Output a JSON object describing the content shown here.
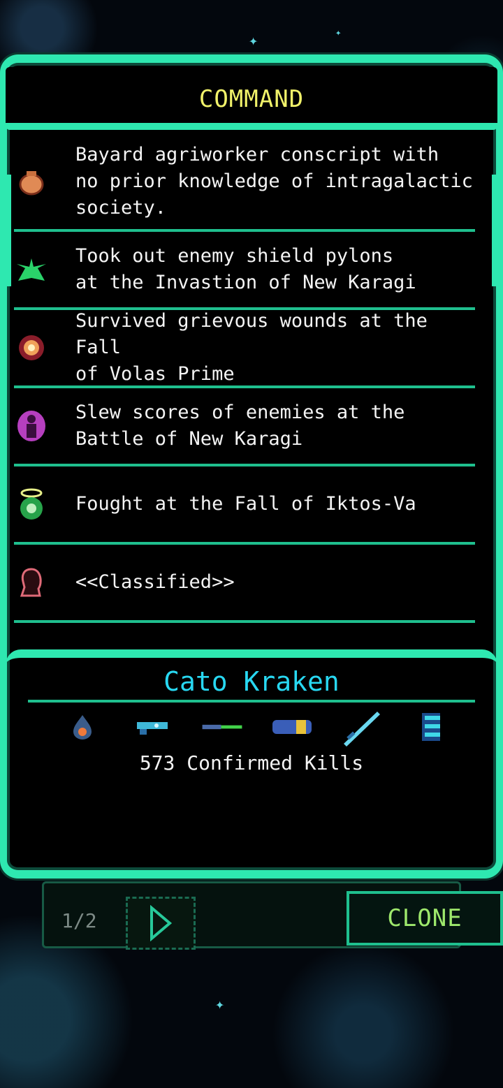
{
  "header": {
    "title": "COMMAND"
  },
  "entries": [
    {
      "icon": "sack-icon",
      "text": "Bayard agriworker conscript with\nno prior knowledge of intragalactic\nsociety."
    },
    {
      "icon": "green-wings-icon",
      "text": "Took out enemy shield pylons\nat the Invastion of New Karagi"
    },
    {
      "icon": "fire-burst-icon",
      "text": "Survived grievous wounds at the Fall\nof Volas Prime"
    },
    {
      "icon": "purple-aura-figure-icon",
      "text": "Slew scores of enemies at the\nBattle of New Karagi"
    },
    {
      "icon": "halo-orb-icon",
      "text": "Fought at the Fall of Iktos-Va"
    },
    {
      "icon": "head-silhouette-icon",
      "text": "<<Classified>>"
    }
  ],
  "profile": {
    "name": "Cato Kraken",
    "kills": "573 Confirmed Kills",
    "gear": [
      "flame-orb-icon",
      "blaster-icon",
      "rifle-icon",
      "ammo-cells-icon",
      "sword-icon",
      "armor-plate-icon"
    ]
  },
  "footer": {
    "page_indicator": "1/2",
    "clone_label": "CLONE"
  },
  "colors": {
    "frame": "#2ee8b0",
    "title": "#f1f26a",
    "name": "#28d8f2",
    "clone_text": "#9ee86c"
  }
}
